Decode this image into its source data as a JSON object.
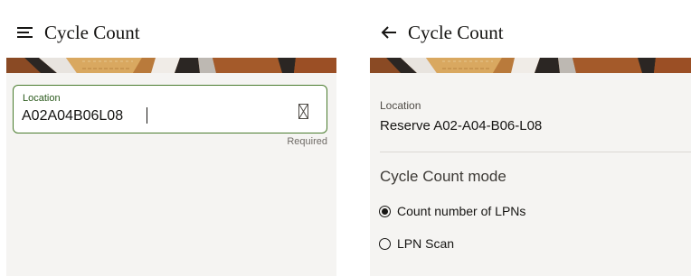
{
  "left_screen": {
    "header": {
      "title": "Cycle Count",
      "menu_icon": "hamburger-menu-icon"
    },
    "location_input": {
      "label": "Location",
      "value": "A02A04B06L08",
      "helper_text": "Required",
      "scan_icon": "barcode-scan-icon"
    }
  },
  "right_screen": {
    "header": {
      "title": "Cycle Count",
      "back_icon": "back-arrow-icon"
    },
    "location": {
      "label": "Location",
      "value": "Reserve A02-A04-B06-L08"
    },
    "mode": {
      "title": "Cycle Count mode",
      "options": [
        {
          "label": "Count number of LPNs",
          "selected": true
        },
        {
          "label": "LPN Scan",
          "selected": false
        }
      ]
    }
  },
  "colors": {
    "panel_background": "#f5f4f2",
    "input_border": "#4a7c2e",
    "banner_orange": "#c2702e"
  }
}
